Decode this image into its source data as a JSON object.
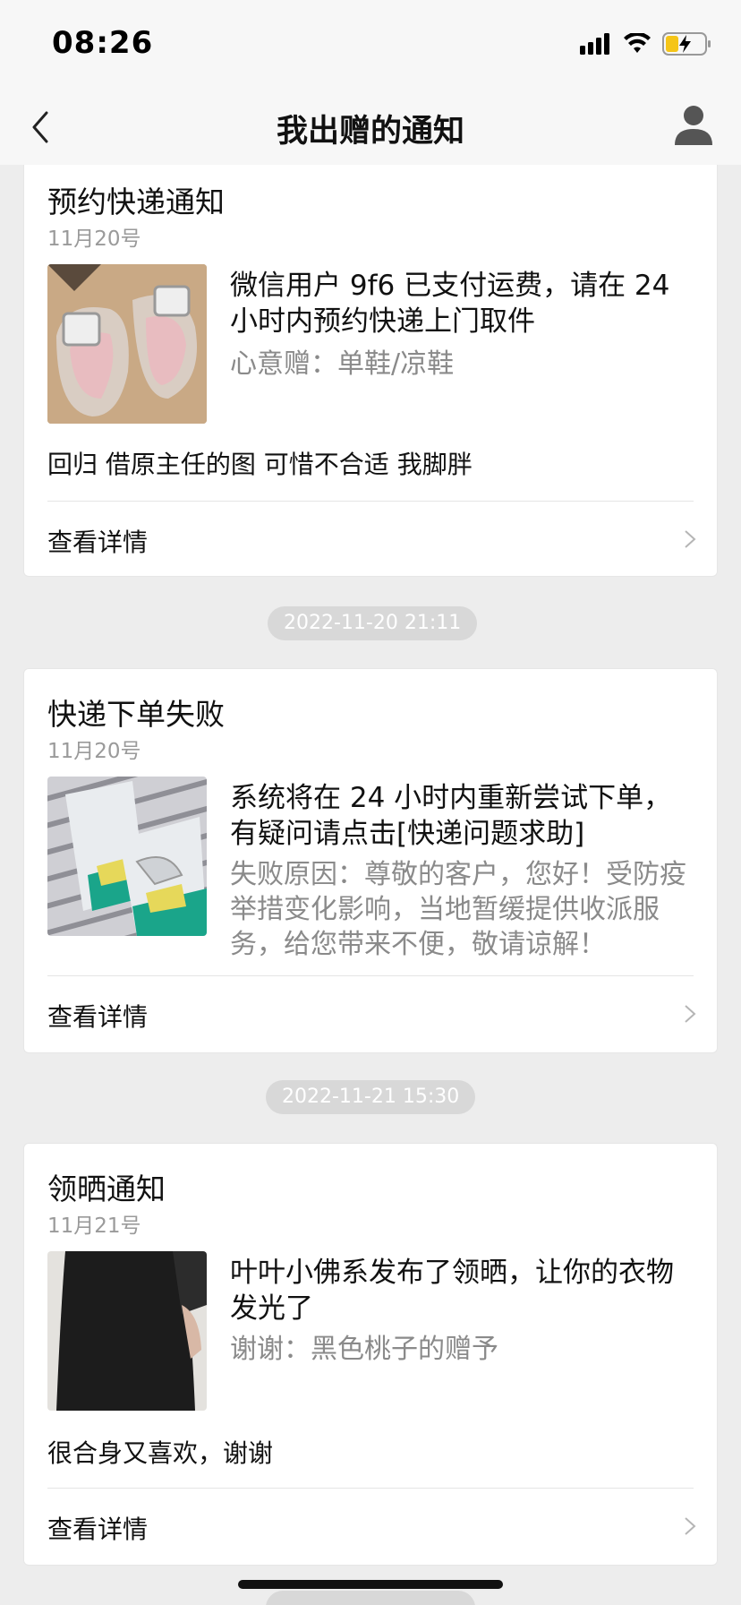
{
  "status": {
    "time": "08:26"
  },
  "nav": {
    "title": "我出赠的通知"
  },
  "cards": [
    {
      "title": "预约快递通知",
      "date": "11月20号",
      "message": "微信用户 9f6 已支付运费，请在 24 小时内预约快递上门取件",
      "sub": "心意赠：单鞋/凉鞋",
      "note": "回归 借原主任的图 可惜不合适 我脚胖",
      "detail": "查看详情"
    },
    {
      "title": "快递下单失败",
      "date": "11月20号",
      "message": "系统将在 24 小时内重新尝试下单，有疑问请点击[快递问题求助]",
      "sub": "失败原因：尊敬的客户，您好！受防疫举措变化影响，当地暂缓提供收派服务，给您带来不便，敬请谅解！",
      "detail": "查看详情"
    },
    {
      "title": "领晒通知",
      "date": "11月21号",
      "message": "叶叶小佛系发布了领晒，让你的衣物发光了",
      "sub": "谢谢：黑色桃子的赠予",
      "note": "很合身又喜欢，谢谢",
      "detail": "查看详情"
    }
  ],
  "timestamps": [
    "2022-11-20 21:11",
    "2022-11-21 15:30"
  ]
}
